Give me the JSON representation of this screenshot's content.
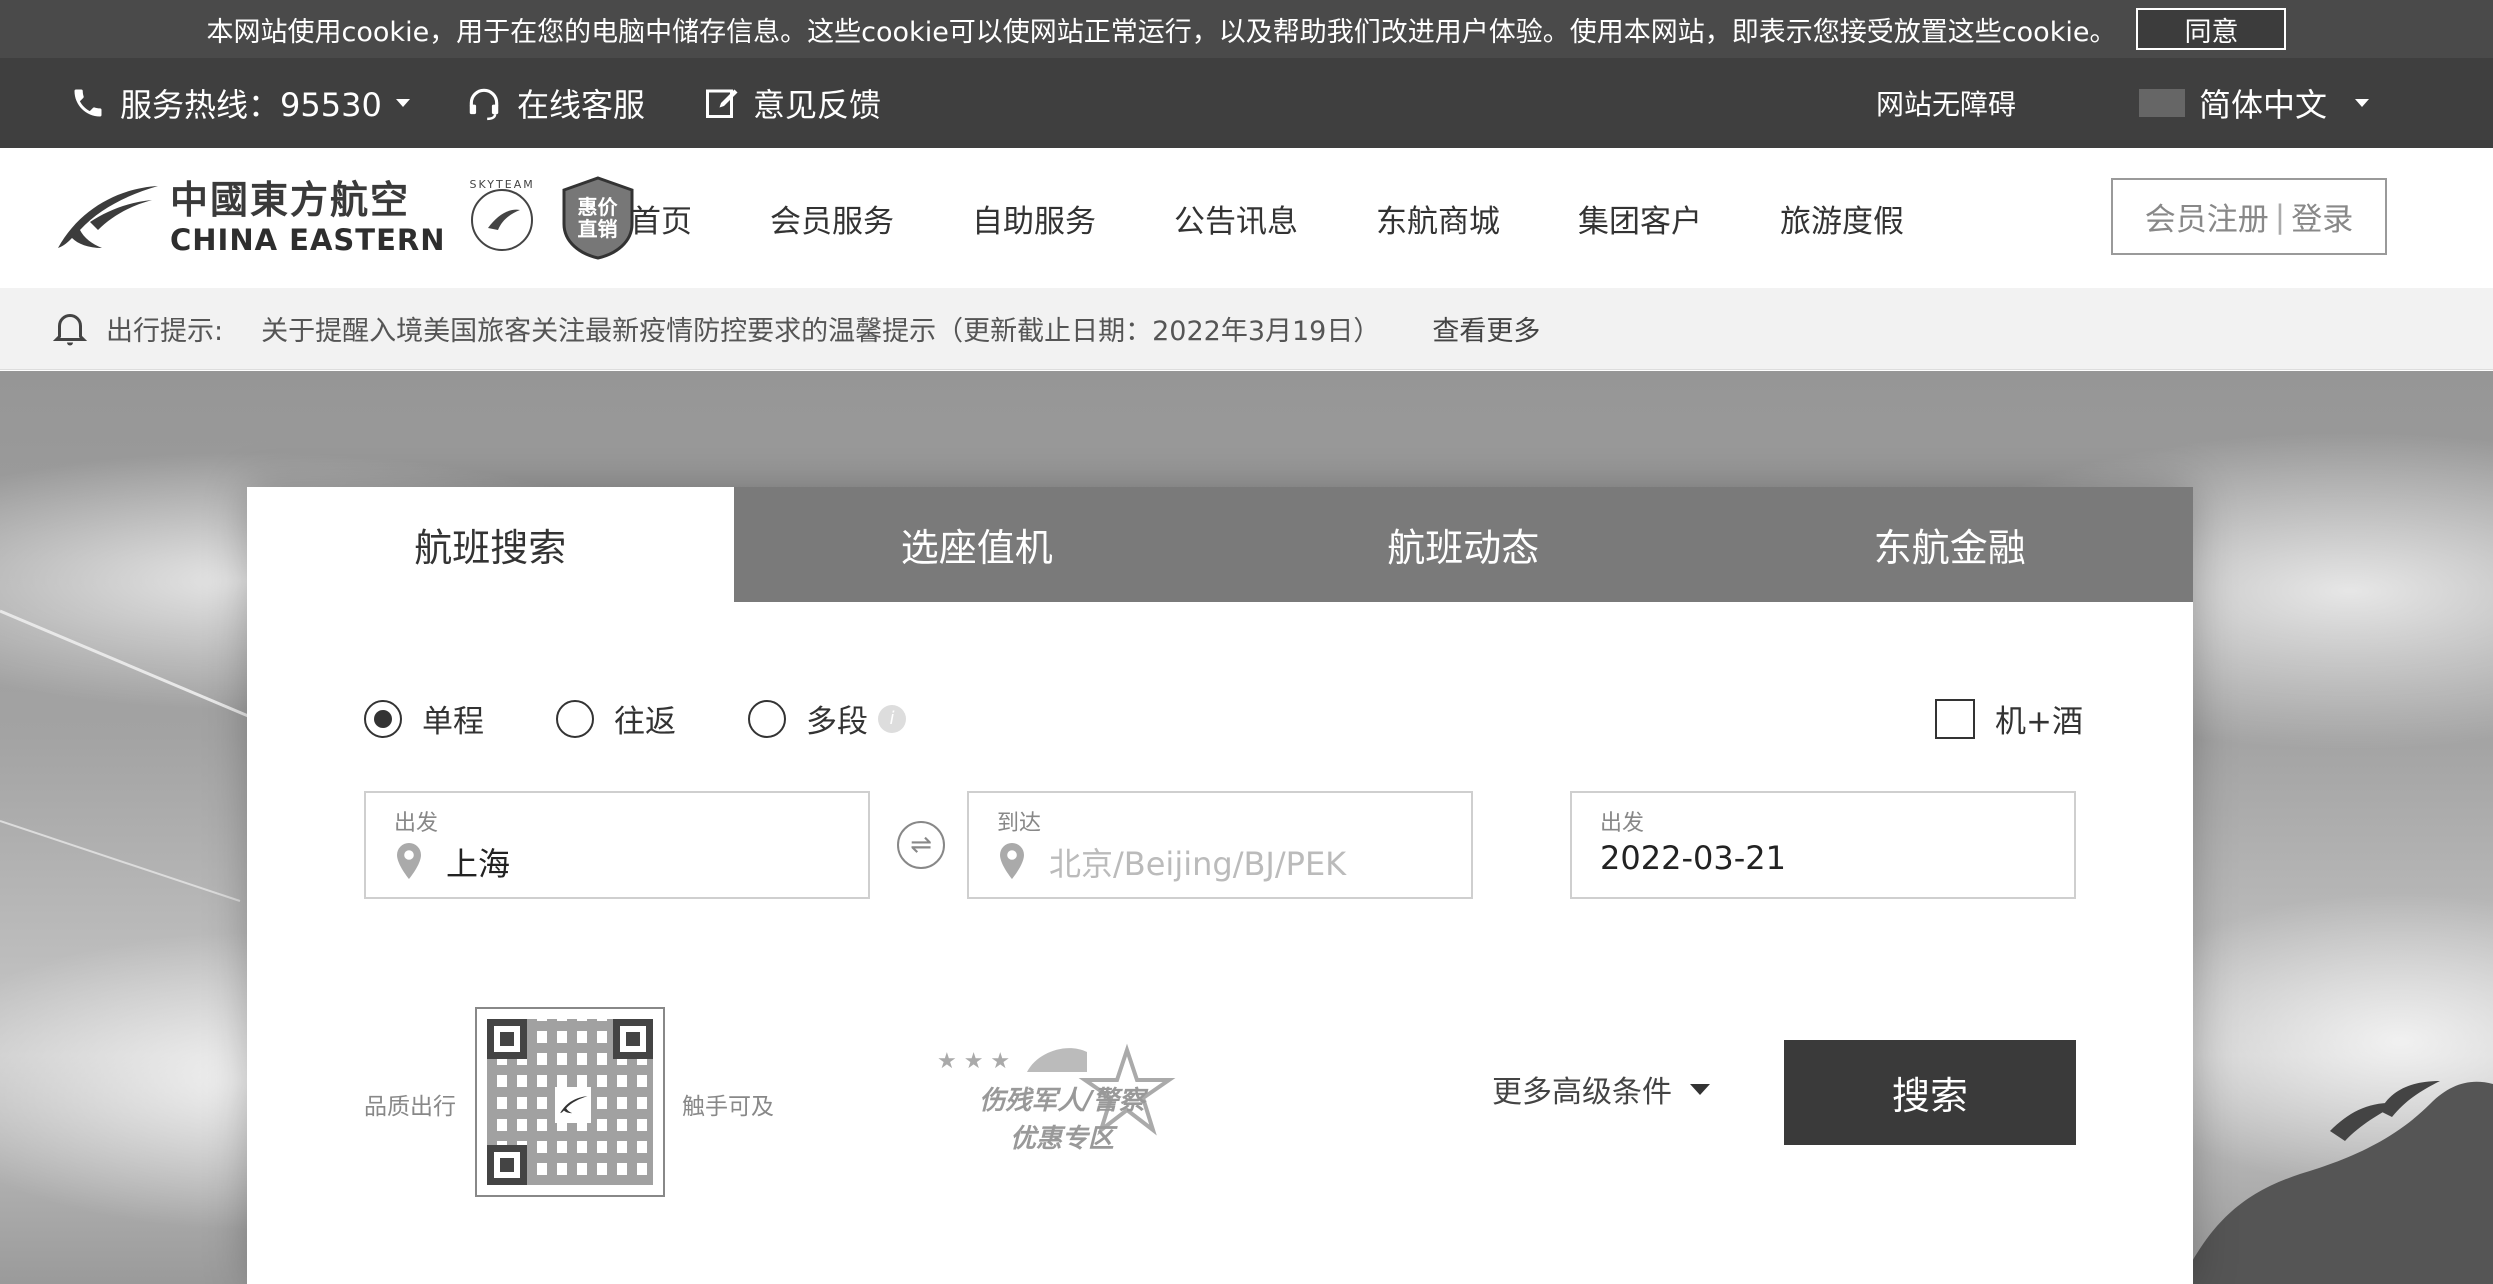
{
  "cookie": {
    "text": "本网站使用cookie，用于在您的电脑中储存信息。这些cookie可以使网站正常运行，以及帮助我们改进用户体验。使用本网站，即表示您接受放置这些cookie。",
    "agree_label": "同意"
  },
  "topbar": {
    "hotline": "服务热线：95530",
    "online_service": "在线客服",
    "feedback": "意见反馈",
    "accessibility": "网站无障碍",
    "language": "简体中文"
  },
  "header": {
    "logo_cn": "中國東方航空",
    "logo_en": "CHINA EASTERN",
    "skyteam": "SKYTEAM",
    "badge": "惠价直销",
    "nav": [
      "首页",
      "会员服务",
      "自助服务",
      "公告讯息",
      "东航商城",
      "集团客户",
      "旅游度假"
    ],
    "register": "会员注册",
    "separator": "|",
    "login": "登录"
  },
  "notice": {
    "label": "出行提示:",
    "text": "关于提醒入境美国旅客关注最新疫情防控要求的温馨提示（更新截止日期：2022年3月19日）",
    "more": "查看更多"
  },
  "search": {
    "tabs": [
      "航班搜索",
      "选座值机",
      "航班动态",
      "东航金融"
    ],
    "active_tab": 0,
    "trip_types": [
      "单程",
      "往返",
      "多段"
    ],
    "selected_trip": "单程",
    "flight_hotel": "机+酒",
    "from_label": "出发",
    "from_value": "上海",
    "to_label": "到达",
    "to_placeholder": "北京/Beijing/BJ/PEK",
    "date_label": "出发",
    "date_value": "2022-03-21",
    "qr_left": "品质出行",
    "qr_right": "触手可及",
    "promo_line1": "伤残军人/警察",
    "promo_line2": "优惠专区",
    "more_conditions": "更多高级条件",
    "search_button": "搜索"
  }
}
